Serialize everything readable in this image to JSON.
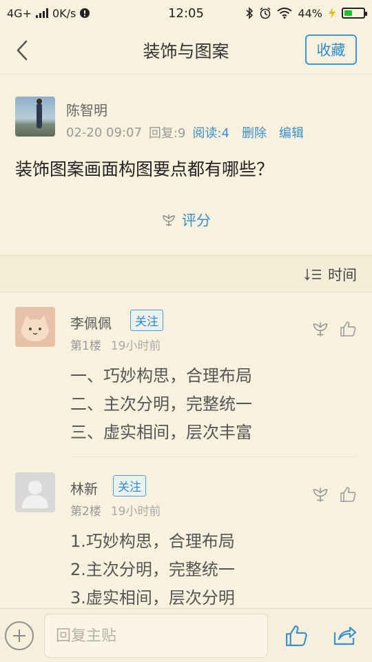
{
  "status_bar": {
    "network": "4G+",
    "speed": "0K/s",
    "time": "12:05",
    "battery": "44%",
    "battery_level": 0.44
  },
  "header": {
    "title": "装饰与图案",
    "favorite_label": "收藏"
  },
  "post": {
    "author": "陈智明",
    "date": "02-20 09:07",
    "replies": "回复:9",
    "reads": "阅读:4",
    "delete_label": "删除",
    "edit_label": "编辑",
    "title": "装饰图案画面构图要点都有哪些？",
    "rate_label": "评分"
  },
  "sort": {
    "label": "时间"
  },
  "replies": [
    {
      "name": "李佩佩",
      "follow_label": "关注",
      "floor": "第1楼",
      "time": "19小时前",
      "lines": [
        "一、巧妙构思，合理布局",
        "二、主次分明，完整统一",
        "三、虚实相间，层次丰富"
      ]
    },
    {
      "name": "林新",
      "follow_label": "关注",
      "floor": "第2楼",
      "time": "19小时前",
      "lines": [
        "1.巧妙构思，合理布局",
        "2.主次分明，完整统一",
        "3.虚实相间，层次分明"
      ]
    }
  ],
  "bottom_bar": {
    "reply_placeholder": "回复主贴"
  },
  "colors": {
    "background": "#f7f1dd",
    "accent_blue": "#3a8fd0",
    "battery_green": "#19c22a"
  }
}
